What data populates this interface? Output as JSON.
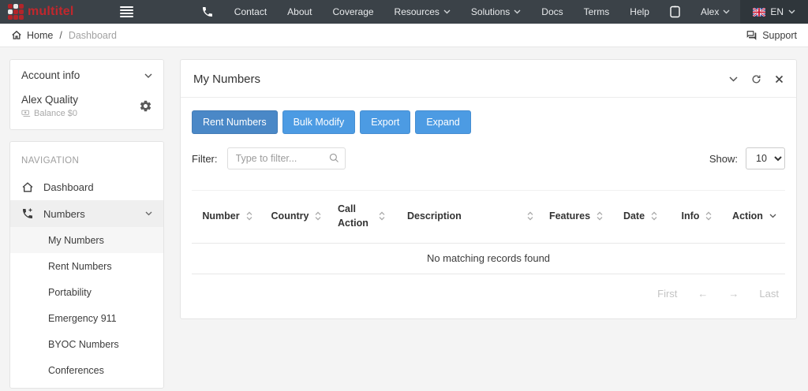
{
  "topbar": {
    "brand": "multitel",
    "nav": [
      {
        "label": "Contact"
      },
      {
        "label": "About"
      },
      {
        "label": "Coverage"
      },
      {
        "label": "Resources",
        "dropdown": true
      },
      {
        "label": "Solutions",
        "dropdown": true
      },
      {
        "label": "Docs"
      },
      {
        "label": "Terms"
      },
      {
        "label": "Help"
      }
    ],
    "user_label": "Alex",
    "language_label": "EN"
  },
  "breadcrumb": {
    "home": "Home",
    "separator": "/",
    "current": "Dashboard",
    "support_label": "Support"
  },
  "sidebar": {
    "account": {
      "title": "Account info",
      "name": "Alex Quality",
      "balance": "Balance $0"
    },
    "nav_title": "NAVIGATION",
    "items": [
      {
        "label": "Dashboard"
      },
      {
        "label": "Numbers",
        "expanded": true
      }
    ],
    "subitems": [
      {
        "label": "My Numbers",
        "active": true
      },
      {
        "label": "Rent Numbers"
      },
      {
        "label": "Portability"
      },
      {
        "label": "Emergency 911"
      },
      {
        "label": "BYOC Numbers"
      },
      {
        "label": "Conferences"
      }
    ]
  },
  "panel": {
    "title": "My Numbers",
    "buttons": [
      {
        "label": "Rent Numbers"
      },
      {
        "label": "Bulk Modify"
      },
      {
        "label": "Export"
      },
      {
        "label": "Expand"
      }
    ],
    "filter_label": "Filter:",
    "filter_value": "",
    "filter_placeholder": "Type to filter...",
    "show_label": "Show:",
    "show_value": "10",
    "table": {
      "columns": [
        "Number",
        "Country",
        "Call Action",
        "Description",
        "Features",
        "Date",
        "Info",
        "Action"
      ],
      "empty_message": "No matching records found"
    },
    "pagination": {
      "first": "First",
      "prev": "←",
      "next": "→",
      "last": "Last"
    }
  },
  "colors": {
    "topbar_bg": "#3b4248",
    "lang_bg": "#2f363b",
    "brand_red": "#c1272d",
    "button_blue": "#4c9be3",
    "button_blue_dark": "#4a88c7",
    "page_bg": "#f4f4f4",
    "active_nav_bg": "#efefef",
    "muted_text": "#9e9e9e"
  }
}
